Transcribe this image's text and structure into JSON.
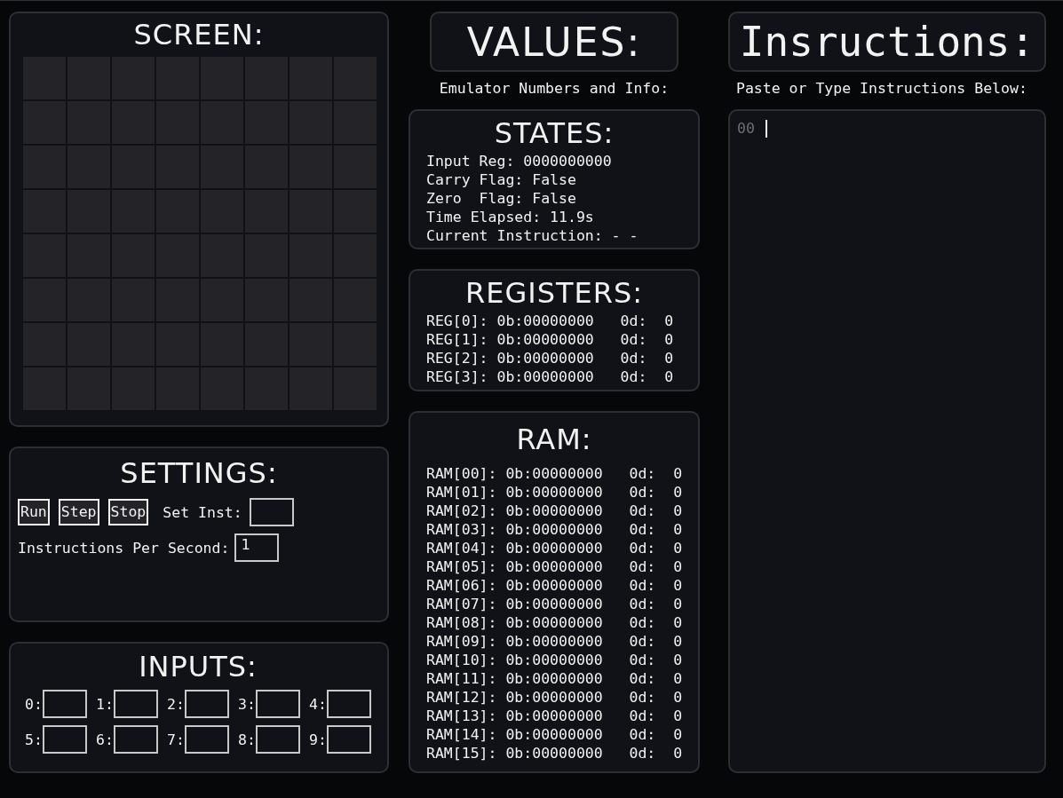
{
  "screen": {
    "title": "SCREEN:",
    "rows": [
      {
        "cells": [
          {
            "on": false
          },
          {
            "on": false
          },
          {
            "on": false
          },
          {
            "on": false
          },
          {
            "on": false
          },
          {
            "on": false
          },
          {
            "on": false
          },
          {
            "on": false
          }
        ]
      },
      {
        "cells": [
          {
            "on": false
          },
          {
            "on": false
          },
          {
            "on": false
          },
          {
            "on": false
          },
          {
            "on": false
          },
          {
            "on": false
          },
          {
            "on": false
          },
          {
            "on": false
          }
        ]
      },
      {
        "cells": [
          {
            "on": false
          },
          {
            "on": false
          },
          {
            "on": false
          },
          {
            "on": false
          },
          {
            "on": false
          },
          {
            "on": false
          },
          {
            "on": false
          },
          {
            "on": false
          }
        ]
      },
      {
        "cells": [
          {
            "on": false
          },
          {
            "on": false
          },
          {
            "on": false
          },
          {
            "on": false
          },
          {
            "on": false
          },
          {
            "on": false
          },
          {
            "on": false
          },
          {
            "on": false
          }
        ]
      },
      {
        "cells": [
          {
            "on": false
          },
          {
            "on": false
          },
          {
            "on": false
          },
          {
            "on": false
          },
          {
            "on": false
          },
          {
            "on": false
          },
          {
            "on": false
          },
          {
            "on": false
          }
        ]
      },
      {
        "cells": [
          {
            "on": false
          },
          {
            "on": false
          },
          {
            "on": false
          },
          {
            "on": false
          },
          {
            "on": false
          },
          {
            "on": false
          },
          {
            "on": false
          },
          {
            "on": false
          }
        ]
      },
      {
        "cells": [
          {
            "on": false
          },
          {
            "on": false
          },
          {
            "on": false
          },
          {
            "on": false
          },
          {
            "on": false
          },
          {
            "on": false
          },
          {
            "on": false
          },
          {
            "on": false
          }
        ]
      },
      {
        "cells": [
          {
            "on": false
          },
          {
            "on": false
          },
          {
            "on": false
          },
          {
            "on": false
          },
          {
            "on": false
          },
          {
            "on": false
          },
          {
            "on": false
          },
          {
            "on": false
          }
        ]
      }
    ]
  },
  "settings": {
    "title": "SETTINGS:",
    "buttons": [
      "Run",
      "Step",
      "Stop"
    ],
    "set_inst": {
      "label": "Set Inst:"
    },
    "speed": {
      "label": "Instructions Per Second:",
      "value": "1"
    }
  },
  "inputs": {
    "title": "INPUTS:",
    "fields": [
      {
        "label": "0:"
      },
      {
        "label": "1:"
      },
      {
        "label": "2:"
      },
      {
        "label": "3:"
      },
      {
        "label": "4:"
      },
      {
        "label": "5:"
      },
      {
        "label": "6:"
      },
      {
        "label": "7:"
      },
      {
        "label": "8:"
      },
      {
        "label": "9:"
      }
    ]
  },
  "values": {
    "title": "VALUES:",
    "subtitle": "Emulator Numbers and Info:"
  },
  "states": {
    "title": "STATES:",
    "lines": [
      "Input Reg: 0000000000",
      "Carry Flag: False",
      "Zero  Flag: False",
      "Time Elapsed: 11.9s",
      "Current Instruction: - -"
    ]
  },
  "registers": {
    "title": "REGISTERS:",
    "lines": [
      "REG[0]: 0b:00000000   0d:  0",
      "REG[1]: 0b:00000000   0d:  0",
      "REG[2]: 0b:00000000   0d:  0",
      "REG[3]: 0b:00000000   0d:  0"
    ]
  },
  "ram": {
    "title": "RAM:",
    "lines": [
      "RAM[00]: 0b:00000000   0d:  0",
      "RAM[01]: 0b:00000000   0d:  0",
      "RAM[02]: 0b:00000000   0d:  0",
      "RAM[03]: 0b:00000000   0d:  0",
      "RAM[04]: 0b:00000000   0d:  0",
      "RAM[05]: 0b:00000000   0d:  0",
      "RAM[06]: 0b:00000000   0d:  0",
      "RAM[07]: 0b:00000000   0d:  0",
      "RAM[08]: 0b:00000000   0d:  0",
      "RAM[09]: 0b:00000000   0d:  0",
      "RAM[10]: 0b:00000000   0d:  0",
      "RAM[11]: 0b:00000000   0d:  0",
      "RAM[12]: 0b:00000000   0d:  0",
      "RAM[13]: 0b:00000000   0d:  0",
      "RAM[14]: 0b:00000000   0d:  0",
      "RAM[15]: 0b:00000000   0d:  0"
    ]
  },
  "instructions": {
    "title": "Insructions:",
    "subtitle": "Paste or Type Instructions Below:",
    "editor": {
      "line_numbers": [
        "00"
      ]
    }
  }
}
